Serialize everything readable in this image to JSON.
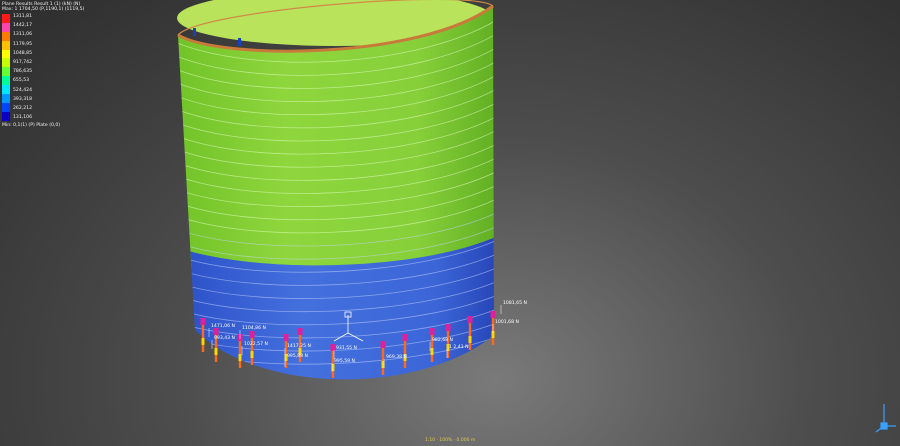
{
  "legend": {
    "title": "Plane Results Result 1 (1) (kN) (N)",
    "max_line": "Max: 1 1704,50 (P,1190,1) (1119,5)",
    "tick_values": [
      "1311,81",
      "1442,17",
      "1311,06",
      "1179,95",
      "1048,85",
      "917,742",
      "786,635",
      "655,53",
      "524,424",
      "393,318",
      "262,212",
      "131,106"
    ],
    "min_line": "Min: 0,1(1) (P) Plate (0,0)",
    "colors": [
      "#ff1a1a",
      "#ff44aa",
      "#ff7a00",
      "#ffc000",
      "#ffff00",
      "#c8ff00",
      "#66ff33",
      "#00ff9a",
      "#00e6ff",
      "#0099ff",
      "#0044ff",
      "#0a00c8"
    ]
  },
  "force_labels": [
    "1471,06 N",
    "1104,86 N",
    "993,43 N",
    "1022,57 N",
    "1417,25 N",
    "995,88 N",
    "995,59 N",
    "931,55 N",
    "969,38 N",
    "982,68 N",
    "1 2,41 N",
    "1001,68 N",
    "1081,65 N"
  ],
  "status_text": "1:10 · 100% · 0.000 m",
  "colors": {
    "green_band": "#8bd437",
    "blue_band": "#3a62d6",
    "rim": "#c87a3a",
    "interior": "#a8dc4a"
  }
}
